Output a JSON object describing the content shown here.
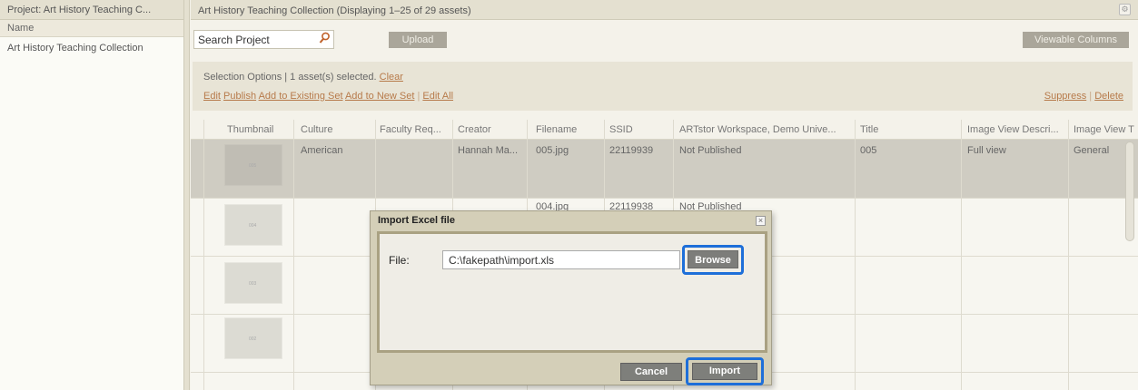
{
  "left_panel": {
    "title": "Project: Art History Teaching C...",
    "column_header": "Name",
    "items": [
      "Art History Teaching Collection"
    ]
  },
  "main": {
    "title": "Art History Teaching Collection  (Displaying 1–25 of 29 assets)",
    "search": {
      "value": "Search Project"
    },
    "upload_label": "Upload",
    "viewable_columns_label": "Viewable Columns"
  },
  "selection": {
    "text": "Selection Options | 1 asset(s) selected.",
    "clear_label": "Clear",
    "actions": [
      "Edit",
      "Publish",
      "Add to Existing Set",
      "Add to New Set",
      "Edit All"
    ],
    "right_actions": [
      "Suppress",
      "Delete"
    ]
  },
  "grid": {
    "columns": [
      "Thumbnail",
      "Culture",
      "Faculty Req...",
      "Creator",
      "Filename",
      "SSID",
      "ARTstor Workspace, Demo Unive...",
      "Title",
      "Image View Descri...",
      "Image View T"
    ],
    "rows": [
      {
        "culture": "American",
        "creator": "Hannah Ma...",
        "filename": "005.jpg",
        "ssid": "22119939",
        "workspace": "Not Published",
        "title": "005",
        "view_desc": "Full view",
        "view_type": "General"
      },
      {
        "culture": "",
        "creator": "",
        "filename": "004.jpg",
        "ssid": "22119938",
        "workspace": "Not Published",
        "title": "",
        "view_desc": "",
        "view_type": ""
      }
    ]
  },
  "modal": {
    "title": "Import Excel file",
    "file_label": "File:",
    "file_value": "C:\\fakepath\\import.xls",
    "browse_label": "Browse",
    "cancel_label": "Cancel",
    "import_label": "Import"
  },
  "colors": {
    "link": "#b77a4a",
    "highlight": "#1e6fd9",
    "header_bg": "#e4e0d0",
    "selected_row": "#cfccc2"
  }
}
